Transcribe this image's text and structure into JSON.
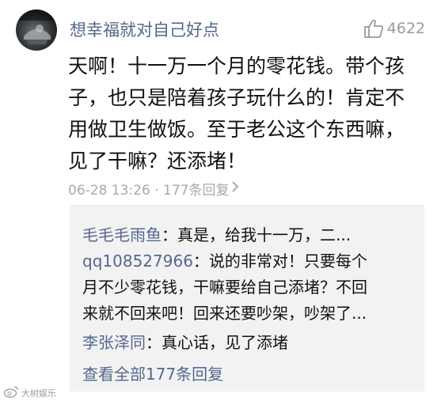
{
  "comment": {
    "username": "想幸福就对自己好点",
    "likes": "4622",
    "text_lines": [
      "天啊！十一万一个月的零花钱。带个孩",
      "子，也只是陪着孩子玩什么的！肯定不",
      "用做卫生做饭。至于老公这个东西嘛，",
      "见了干嘛？还添堵！"
    ],
    "meta": "06-28 13:26 · 177条回复"
  },
  "replies": [
    {
      "name": "毛毛毛雨鱼",
      "lines": [
        "：真是，给我十一万，二..."
      ]
    },
    {
      "name": "qq108527966",
      "lines": [
        "：说的非常对！只要每个",
        "月不少零花钱，干嘛要给自己添堵？不回",
        "来就不回来吧！回来还要吵架，吵架了..."
      ]
    },
    {
      "name": "李张泽同",
      "lines": [
        "：真心话，见了添堵"
      ]
    }
  ],
  "more_replies": "查看全部177条回复",
  "watermark": "大树娱乐",
  "icons": {
    "like": "thumbs-up-icon",
    "chevron": "chevron-right-icon",
    "watermark": "weibo-logo-icon",
    "avatar": "avatar"
  },
  "colors": {
    "name_link": "#53688f",
    "meta_gray": "#a9a9a9",
    "reply_bg": "#f2f2f2"
  }
}
